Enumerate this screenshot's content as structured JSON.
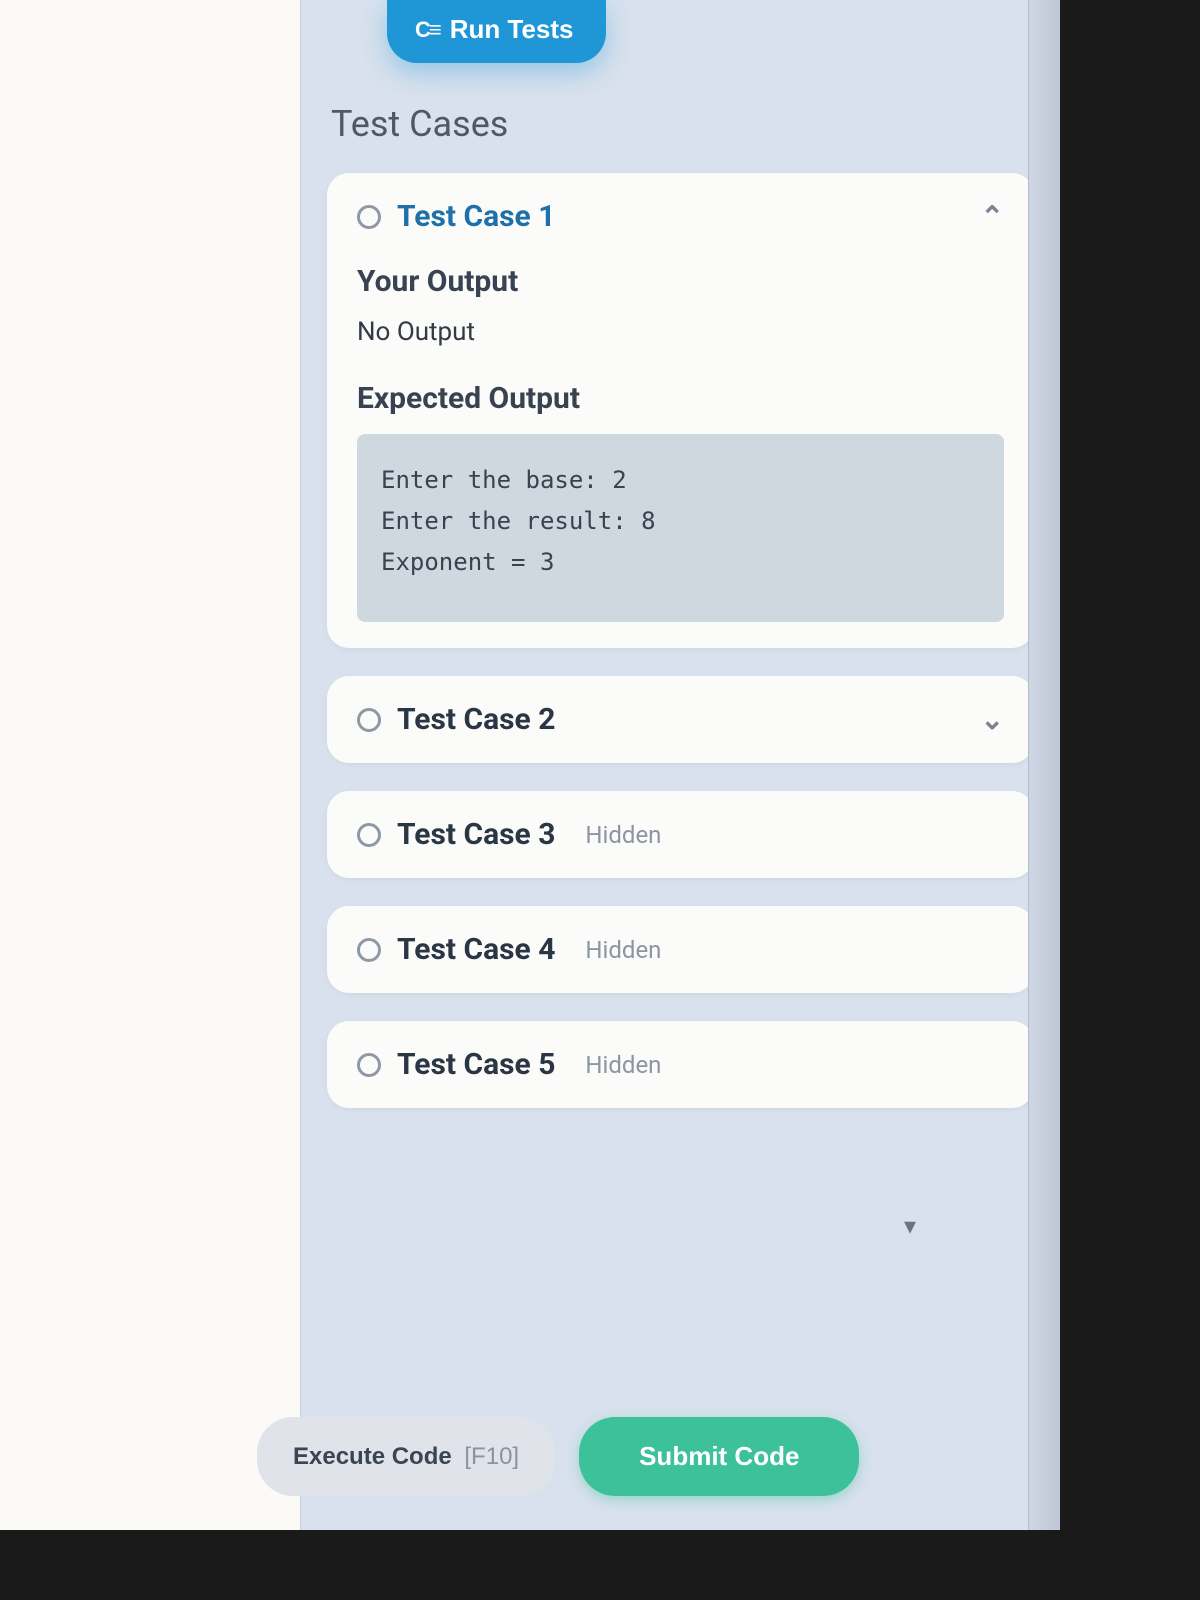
{
  "toolbar": {
    "run_tests_label": "Run Tests"
  },
  "section": {
    "title": "Test Cases"
  },
  "testCases": [
    {
      "title": "Test Case 1",
      "expanded": true,
      "your_output_label": "Your Output",
      "your_output_value": "No Output",
      "expected_output_label": "Expected Output",
      "expected_output_value": "Enter the base: 2\nEnter the result: 8\nExponent = 3"
    },
    {
      "title": "Test Case 2",
      "hidden": false
    },
    {
      "title": "Test Case 3",
      "hidden": true,
      "hidden_label": "Hidden"
    },
    {
      "title": "Test Case 4",
      "hidden": true,
      "hidden_label": "Hidden"
    },
    {
      "title": "Test Case 5",
      "hidden": true,
      "hidden_label": "Hidden"
    }
  ],
  "footer": {
    "execute_label": "Execute Code",
    "execute_hint": "[F10]",
    "submit_label": "Submit Code"
  }
}
